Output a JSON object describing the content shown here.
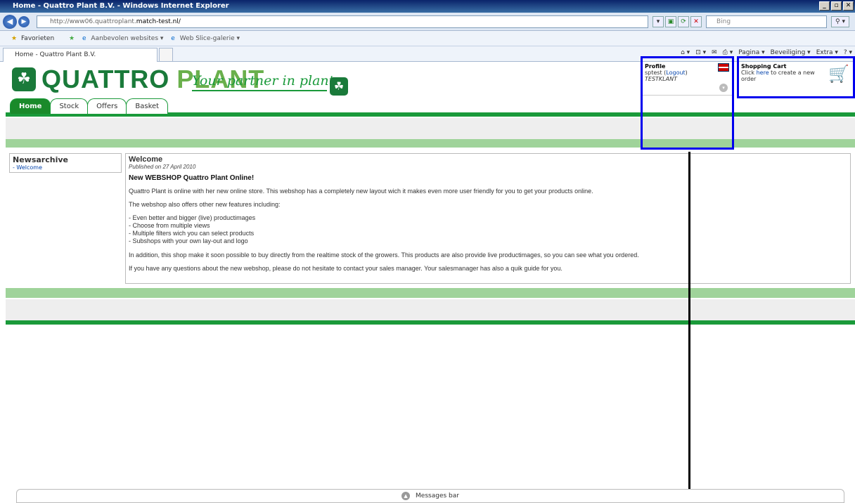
{
  "window": {
    "title": "Home - Quattro Plant B.V. - Windows Internet Explorer"
  },
  "browser": {
    "url_prefix": "http://www06.quattroplant.",
    "url_domain": "match-test.nl/",
    "search_placeholder": "Bing",
    "favorites": "Favorieten",
    "fav_links": [
      "Aanbevolen websites ▾",
      "Web Slice-galerie ▾"
    ],
    "tab_title": "Home - Quattro Plant B.V.",
    "commands": [
      "Pagina ▾",
      "Beveiliging ▾",
      "Extra ▾"
    ]
  },
  "site": {
    "logo_left": "QUATTRO",
    "logo_right": "PLANT",
    "slogan": "Your partner in plants",
    "nav": [
      "Home",
      "Stock",
      "Offers",
      "Basket"
    ]
  },
  "profile": {
    "title": "Profile",
    "user": "sptest",
    "logout": "Logout",
    "customer": "TESTKLANT"
  },
  "cart": {
    "title": "Shopping Cart",
    "text_before": "Click ",
    "link": "here",
    "text_after": " to create a new order"
  },
  "newsarchive": {
    "title": "Newsarchive",
    "items": [
      "- Welcome"
    ]
  },
  "article": {
    "title": "Welcome",
    "published": "Published on 27 April 2010",
    "headline": "New WEBSHOP Quattro Plant Online!",
    "p1": "Quattro Plant is online with her new online store. This webshop has a completely new layout wich it makes even more user friendly for you to get your products online.",
    "p2": "The webshop also offers other new features including:",
    "bullets": [
      "- Even better and bigger (live) productimages",
      "- Choose from multiple views",
      "- Multiple filters wich you can select products",
      "- Subshops with your own lay-out and logo"
    ],
    "p3": "In addition, this shop make it soon possible to buy directly from the realtime stock of the growers. This products are also provide live productimages, so you can see what you ordered.",
    "p4": "If you have any questions about the new webshop, please do not hesitate to contact your sales manager. Your salesmanager has also a quik guide for you."
  },
  "messages_bar": "Messages bar"
}
